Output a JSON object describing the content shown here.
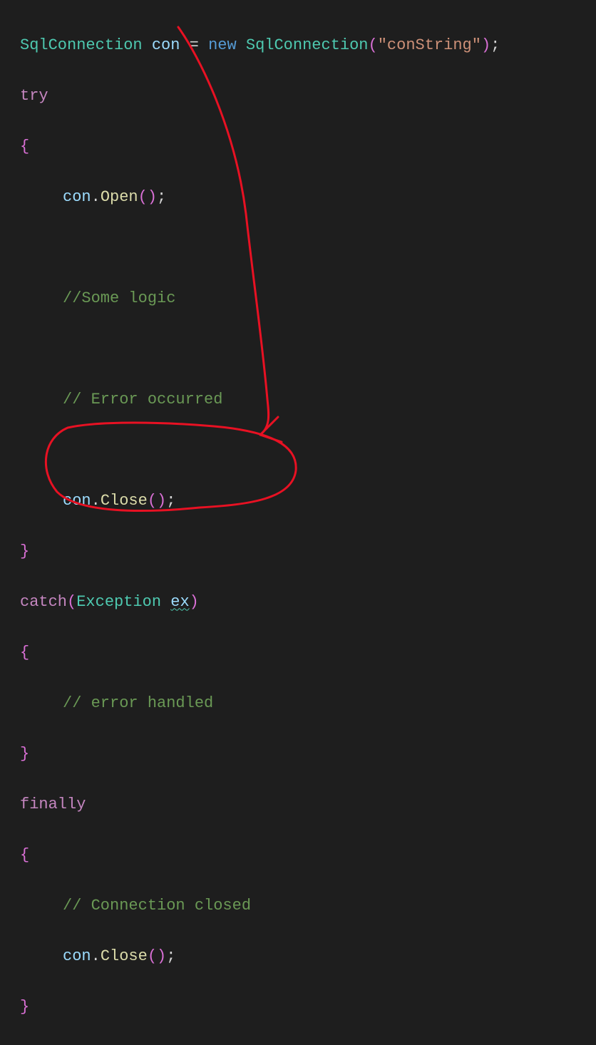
{
  "code": {
    "l1": {
      "type1": "SqlConnection",
      "var": "con",
      "eq": "=",
      "newkw": "new",
      "type2": "SqlConnection",
      "lpar": "(",
      "str": "\"conString\"",
      "rpar": ")",
      "semi": ";"
    },
    "l2": {
      "try": "try"
    },
    "l3": {
      "brace": "{"
    },
    "l4": {
      "var": "con",
      "dot": ".",
      "method": "Open",
      "lp": "(",
      "rp": ")",
      "semi": ";"
    },
    "l5": {
      "comment": "//Some logic"
    },
    "l6": {
      "comment": "// Error occurred"
    },
    "l7": {
      "var": "con",
      "dot": ".",
      "method": "Close",
      "lp": "(",
      "rp": ")",
      "semi": ";"
    },
    "l8": {
      "brace": "}"
    },
    "l9": {
      "catch": "catch",
      "lp": "(",
      "type": "Exception",
      "ex": "ex",
      "rp": ")"
    },
    "l10": {
      "brace": "{"
    },
    "l11": {
      "comment": "// error handled"
    },
    "l12": {
      "brace": "}"
    },
    "l13": {
      "finally": "finally"
    },
    "l14": {
      "brace": "{"
    },
    "l15": {
      "comment": "// Connection closed"
    },
    "l16": {
      "var": "con",
      "dot": ".",
      "method": "Close",
      "lp": "(",
      "rp": ")",
      "semi": ";"
    },
    "l17": {
      "brace": "}"
    }
  },
  "annotation": {
    "color": "#e81123",
    "description": "hand-drawn arrow from 'con' variable down to finally block with circled region around con.Close()"
  }
}
